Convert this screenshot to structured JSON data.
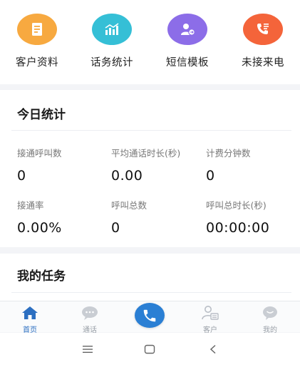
{
  "quick_actions": [
    {
      "label": "客户资料",
      "icon": "document-icon",
      "color": "#f7a940"
    },
    {
      "label": "话务统计",
      "icon": "bar-chart-icon",
      "color": "#35bfd6"
    },
    {
      "label": "短信模板",
      "icon": "user-message-icon",
      "color": "#8c6de8"
    },
    {
      "label": "未接来电",
      "icon": "missed-call-icon",
      "color": "#f4643a"
    }
  ],
  "today": {
    "title": "今日统计",
    "stats": [
      {
        "label": "接通呼叫数",
        "value": "0"
      },
      {
        "label": "平均通话时长(秒)",
        "value": "0.00"
      },
      {
        "label": "计费分钟数",
        "value": "0"
      },
      {
        "label": "接通率",
        "value": "0.00%"
      },
      {
        "label": "呼叫总数",
        "value": "0"
      },
      {
        "label": "呼叫总时长(秒)",
        "value": "00:00:00"
      }
    ]
  },
  "tasks": {
    "title": "我的任务"
  },
  "tabbar": {
    "home": {
      "label": "首页",
      "icon": "home-icon",
      "active": true
    },
    "calls": {
      "label": "通话",
      "icon": "chat-bubble-icon"
    },
    "dial": {
      "icon": "phone-icon",
      "color": "#2a7fd4"
    },
    "customers": {
      "label": "客户",
      "icon": "customer-card-icon"
    },
    "mine": {
      "label": "我的",
      "icon": "profile-bubble-icon"
    }
  },
  "system_nav": [
    "menu-icon",
    "home-square-icon",
    "back-chevron-icon"
  ],
  "colors": {
    "accent": "#2c6fc1",
    "background": "#f3f4f7"
  }
}
